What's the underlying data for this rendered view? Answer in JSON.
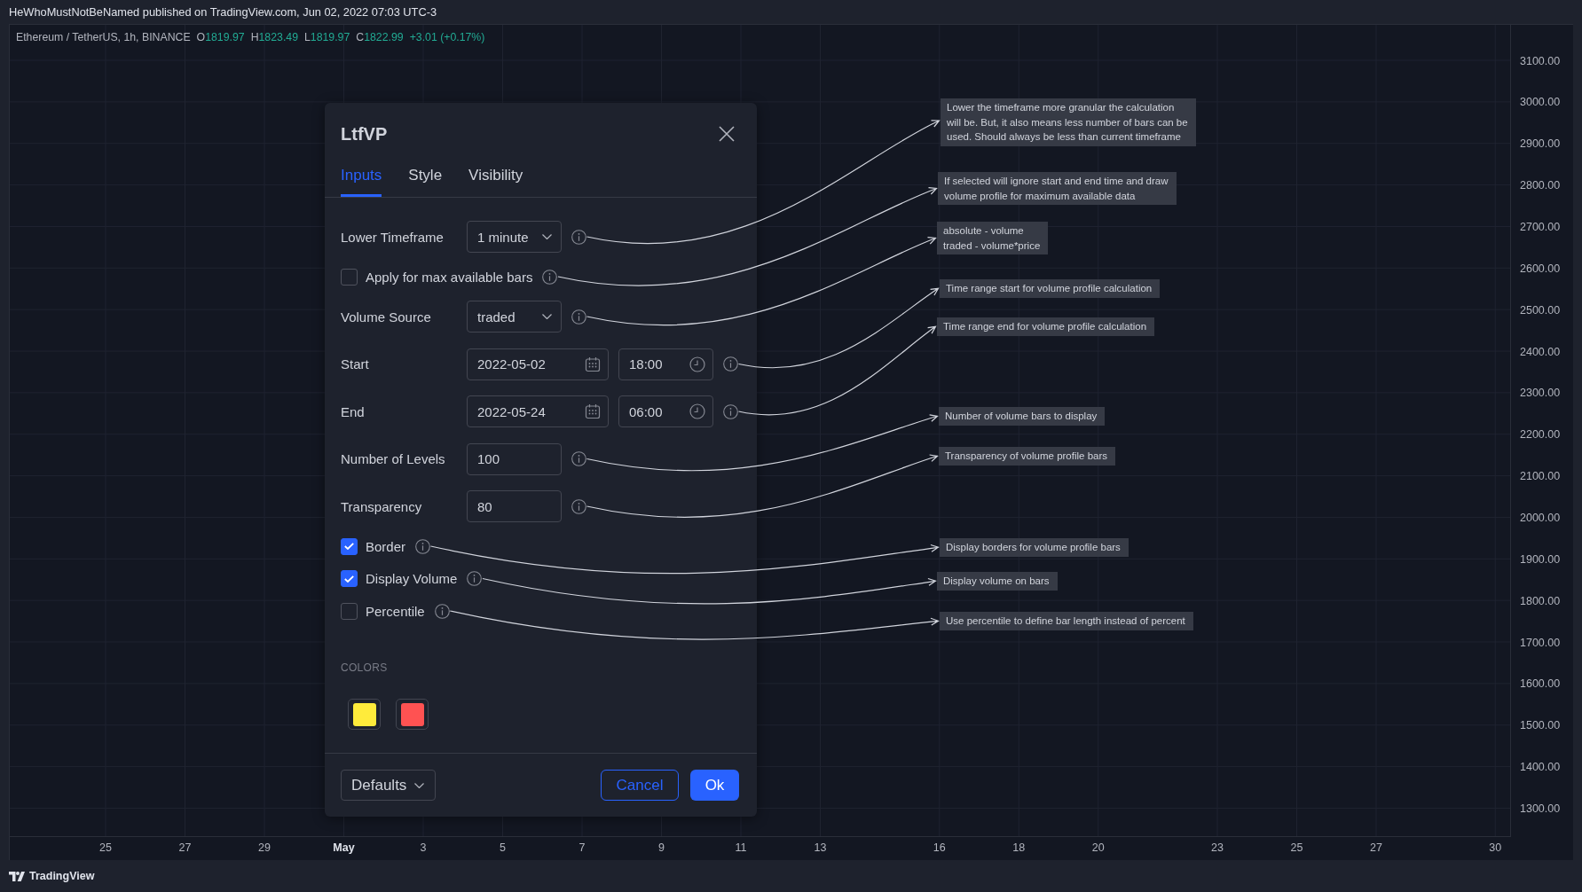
{
  "header": {
    "publisher_line": "HeWhoMustNotBeNamed published on TradingView.com, Jun 02, 2022 07:03 UTC-3"
  },
  "legend": {
    "symbol": "Ethereum / TetherUS, 1h, BINANCE",
    "values": [
      {
        "label": "O",
        "value": "1819.97"
      },
      {
        "label": "H",
        "value": "1823.49"
      },
      {
        "label": "L",
        "value": "1819.97"
      },
      {
        "label": "C",
        "value": "1822.99"
      }
    ],
    "change": "+3.01 (+0.17%)"
  },
  "price_axis": {
    "labels": [
      "3100.00",
      "3000.00",
      "2900.00",
      "2800.00",
      "2700.00",
      "2600.00",
      "2500.00",
      "2400.00",
      "2300.00",
      "2200.00",
      "2100.00",
      "2000.00",
      "1900.00",
      "1800.00",
      "1700.00",
      "1600.00",
      "1500.00",
      "1400.00",
      "1300.00"
    ]
  },
  "time_axis": {
    "labels": [
      {
        "text": "25",
        "kind": "day"
      },
      {
        "text": "27",
        "kind": "day"
      },
      {
        "text": "29",
        "kind": "day"
      },
      {
        "text": "May",
        "kind": "month"
      },
      {
        "text": "3",
        "kind": "day"
      },
      {
        "text": "5",
        "kind": "day"
      },
      {
        "text": "7",
        "kind": "day"
      },
      {
        "text": "9",
        "kind": "day"
      },
      {
        "text": "11",
        "kind": "day"
      },
      {
        "text": "13",
        "kind": "day"
      },
      {
        "text": "16",
        "kind": "day"
      },
      {
        "text": "18",
        "kind": "day"
      },
      {
        "text": "20",
        "kind": "day"
      },
      {
        "text": "23",
        "kind": "day"
      },
      {
        "text": "25",
        "kind": "day"
      },
      {
        "text": "27",
        "kind": "day"
      },
      {
        "text": "30",
        "kind": "day"
      }
    ]
  },
  "dialog": {
    "title": "LtfVP",
    "tabs": [
      {
        "label": "Inputs",
        "selected": true
      },
      {
        "label": "Style",
        "selected": false
      },
      {
        "label": "Visibility",
        "selected": false
      }
    ],
    "inputs": [
      {
        "kind": "select",
        "label": "Lower Timeframe",
        "value": "1 minute",
        "tooltip": "Lower the timeframe more granular the calculation\nwill be. But, it also means less number of bars can be\nused. Should always be less than current timeframe"
      },
      {
        "kind": "checkbox",
        "label": "Apply for max available bars",
        "checked": false,
        "tooltip": "If selected will ignore start and end time and draw\nvolume profile for maximum available data"
      },
      {
        "kind": "select",
        "label": "Volume Source",
        "value": "traded",
        "tooltip": "absolute - volume\ntraded - volume*price"
      },
      {
        "kind": "datetime",
        "label": "Start",
        "date": "2022-05-02",
        "time": "18:00",
        "tooltip": "Time range start for volume profile calculation"
      },
      {
        "kind": "datetime",
        "label": "End",
        "date": "2022-05-24",
        "time": "06:00",
        "tooltip": "Time range end for volume profile calculation"
      },
      {
        "kind": "number",
        "label": "Number of Levels",
        "value": "100",
        "tooltip": "Number of volume bars to display"
      },
      {
        "kind": "number",
        "label": "Transparency",
        "value": "80",
        "tooltip": "Transparency of volume profile bars"
      },
      {
        "kind": "checkbox",
        "label": "Border",
        "checked": true,
        "tooltip": "Display borders for volume profile bars"
      },
      {
        "kind": "checkbox",
        "label": "Display Volume",
        "checked": true,
        "tooltip": "Display volume on bars"
      },
      {
        "kind": "checkbox",
        "label": "Percentile",
        "checked": false,
        "tooltip": "Use percentile to define bar length instead of percent"
      }
    ],
    "colors": {
      "heading": "COLORS",
      "swatches": [
        {
          "color": "#ffeb3b"
        },
        {
          "color": "#ff5252"
        }
      ]
    },
    "footer": {
      "defaults_button": "Defaults",
      "cancel_button": "Cancel",
      "ok_button": "Ok"
    }
  },
  "footer_bar": {
    "brand": "TradingView"
  }
}
